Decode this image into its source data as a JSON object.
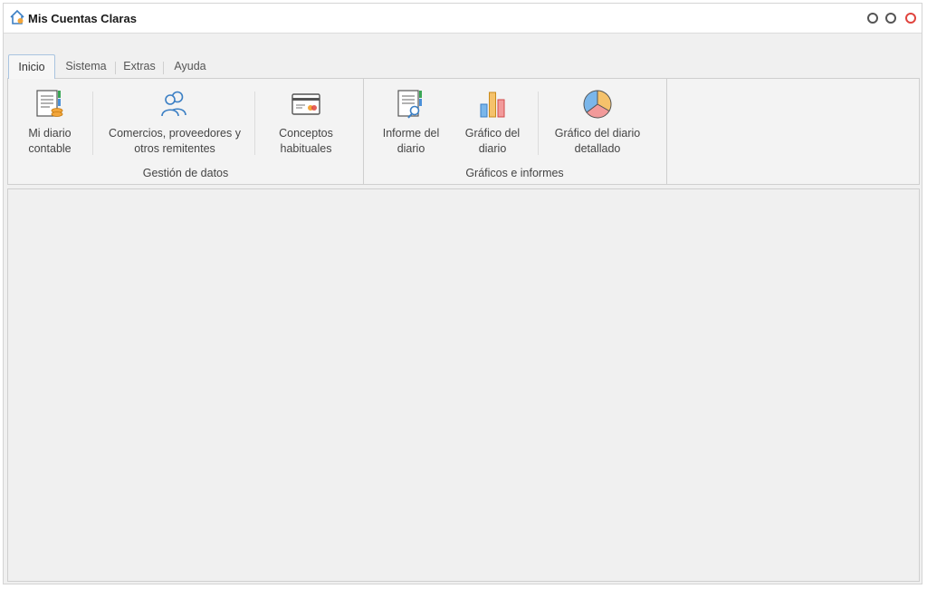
{
  "app": {
    "title": "Mis Cuentas Claras",
    "icon": "home-icon"
  },
  "window_controls": [
    {
      "name": "minimize",
      "color": "#555555"
    },
    {
      "name": "maximize",
      "color": "#555555"
    },
    {
      "name": "close",
      "color": "#e0443e"
    }
  ],
  "tabs": [
    {
      "label": "Inicio",
      "active": true
    },
    {
      "label": "Sistema",
      "active": false
    },
    {
      "label": "Extras",
      "active": false
    },
    {
      "label": "Ayuda",
      "active": false
    }
  ],
  "ribbon": {
    "groups": [
      {
        "label": "Gestión de datos",
        "buttons": [
          {
            "label_line1": "Mi diario",
            "label_line2": "contable",
            "icon": "journal-icon"
          },
          {
            "label_line1": "Comercios, proveedores y",
            "label_line2": "otros remitentes",
            "icon": "people-icon"
          },
          {
            "label_line1": "Conceptos",
            "label_line2": "habituales",
            "icon": "card-icon"
          }
        ]
      },
      {
        "label": "Gráficos e informes",
        "buttons": [
          {
            "label_line1": "Informe del",
            "label_line2": "diario",
            "icon": "report-icon"
          },
          {
            "label_line1": "Gráfico del",
            "label_line2": "diario",
            "icon": "bar-chart-icon"
          },
          {
            "label_line1": "Gráfico del diario",
            "label_line2": "detallado",
            "icon": "pie-chart-icon"
          }
        ]
      }
    ]
  },
  "colors": {
    "accent": "#4a90d9",
    "close": "#e0443e"
  }
}
